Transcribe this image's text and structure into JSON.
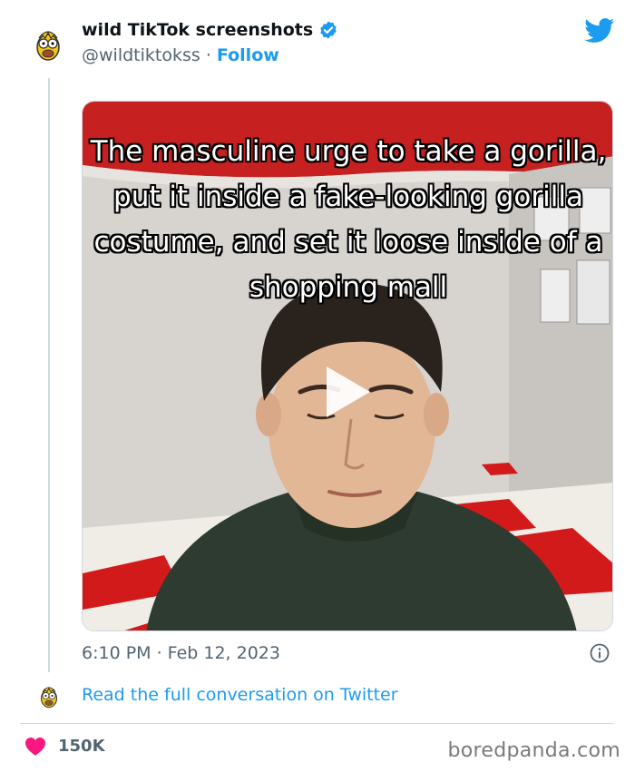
{
  "tweet": {
    "author_name": "wild TikTok screenshots",
    "handle": "@wildtiktokss",
    "separator": "·",
    "follow_label": "Follow",
    "video_caption": "The masculine urge to take a gorilla, put it inside a fake-looking gorilla costume, and set it loose inside of a shopping mall",
    "timestamp": "6:10 PM · Feb 12, 2023",
    "read_more_label": "Read the full conversation on Twitter",
    "likes": "150K"
  },
  "footer": {
    "watermark": "boredpanda.com"
  },
  "icons": {
    "verified": "verified-badge-icon",
    "platform": "twitter-bird-icon",
    "play": "play-icon",
    "info": "info-icon",
    "like": "heart-icon"
  },
  "colors": {
    "accent": "#1d9bf0",
    "like": "#f91880",
    "muted_text": "#536471"
  }
}
